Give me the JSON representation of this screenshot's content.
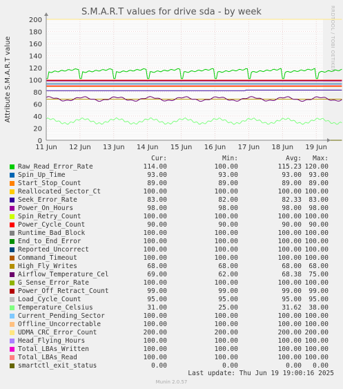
{
  "chart_data": {
    "type": "line",
    "title": "S.M.A.R.T values for drive sda - by week",
    "ylabel": "Attribute S.M.A.R.T value",
    "ylim": [
      0,
      200
    ],
    "yticks": [
      0,
      20,
      40,
      60,
      80,
      100,
      120,
      140,
      160,
      180,
      200
    ],
    "xlim": [
      "2025-06-11",
      "2025-06-19 19:00"
    ],
    "xticks": [
      "11 Jun",
      "12 Jun",
      "13 Jun",
      "14 Jun",
      "15 Jun",
      "16 Jun",
      "17 Jun",
      "18 Jun",
      "19 Jun"
    ],
    "grid": true,
    "series": [
      {
        "name": "Raw_Read_Error_Rate",
        "color": "#00cc00",
        "cur": "114.00",
        "min": "100.00",
        "avg": "115.23",
        "max": "120.00"
      },
      {
        "name": "Spin_Up_Time",
        "color": "#0066b3",
        "cur": "93.00",
        "min": "93.00",
        "avg": "93.00",
        "max": "93.00"
      },
      {
        "name": "Start_Stop_Count",
        "color": "#ff8000",
        "cur": "89.00",
        "min": "89.00",
        "avg": "89.00",
        "max": "89.00"
      },
      {
        "name": "Reallocated_Sector_Ct",
        "color": "#ffcc00",
        "cur": "100.00",
        "min": "100.00",
        "avg": "100.00",
        "max": "100.00"
      },
      {
        "name": "Seek_Error_Rate",
        "color": "#330099",
        "cur": "83.00",
        "min": "82.00",
        "avg": "82.33",
        "max": "83.00"
      },
      {
        "name": "Power_On_Hours",
        "color": "#990099",
        "cur": "98.00",
        "min": "98.00",
        "avg": "98.00",
        "max": "98.00"
      },
      {
        "name": "Spin_Retry_Count",
        "color": "#ccff00",
        "cur": "100.00",
        "min": "100.00",
        "avg": "100.00",
        "max": "100.00"
      },
      {
        "name": "Power_Cycle_Count",
        "color": "#ff0000",
        "cur": "90.00",
        "min": "90.00",
        "avg": "90.00",
        "max": "90.00"
      },
      {
        "name": "Runtime_Bad_Block",
        "color": "#808080",
        "cur": "100.00",
        "min": "100.00",
        "avg": "100.00",
        "max": "100.00"
      },
      {
        "name": "End_to_End_Error",
        "color": "#008f00",
        "cur": "100.00",
        "min": "100.00",
        "avg": "100.00",
        "max": "100.00"
      },
      {
        "name": "Reported_Uncorrect",
        "color": "#00487d",
        "cur": "100.00",
        "min": "100.00",
        "avg": "100.00",
        "max": "100.00"
      },
      {
        "name": "Command_Timeout",
        "color": "#b35a00",
        "cur": "100.00",
        "min": "100.00",
        "avg": "100.00",
        "max": "100.00"
      },
      {
        "name": "High_Fly_Writes",
        "color": "#b38f00",
        "cur": "68.00",
        "min": "68.00",
        "avg": "68.00",
        "max": "68.00"
      },
      {
        "name": "Airflow_Temperature_Cel",
        "color": "#6b006b",
        "cur": "69.00",
        "min": "62.00",
        "avg": "68.38",
        "max": "75.00"
      },
      {
        "name": "G_Sense_Error_Rate",
        "color": "#8fb300",
        "cur": "100.00",
        "min": "100.00",
        "avg": "100.00",
        "max": "100.00"
      },
      {
        "name": "Power_Off_Retract_Count",
        "color": "#b30000",
        "cur": "99.00",
        "min": "99.00",
        "avg": "99.00",
        "max": "99.00"
      },
      {
        "name": "Load_Cycle_Count",
        "color": "#bebebe",
        "cur": "95.00",
        "min": "95.00",
        "avg": "95.00",
        "max": "95.00"
      },
      {
        "name": "Temperature_Celsius",
        "color": "#80ff80",
        "cur": "31.00",
        "min": "25.00",
        "avg": "31.62",
        "max": "38.00"
      },
      {
        "name": "Current_Pending_Sector",
        "color": "#80c9ff",
        "cur": "100.00",
        "min": "100.00",
        "avg": "100.00",
        "max": "100.00"
      },
      {
        "name": "Offline_Uncorrectable",
        "color": "#ffc080",
        "cur": "100.00",
        "min": "100.00",
        "avg": "100.00",
        "max": "100.00"
      },
      {
        "name": "UDMA_CRC_Error_Count",
        "color": "#ffe680",
        "cur": "200.00",
        "min": "200.00",
        "avg": "200.00",
        "max": "200.00"
      },
      {
        "name": "Head_Flying_Hours",
        "color": "#aa80ff",
        "cur": "100.00",
        "min": "100.00",
        "avg": "100.00",
        "max": "100.00"
      },
      {
        "name": "Total_LBAs_Written",
        "color": "#ee00cc",
        "cur": "100.00",
        "min": "100.00",
        "avg": "100.00",
        "max": "100.00"
      },
      {
        "name": "Total_LBAs_Read",
        "color": "#ff8080",
        "cur": "100.00",
        "min": "100.00",
        "avg": "100.00",
        "max": "100.00"
      },
      {
        "name": "smartctl_exit_status",
        "color": "#666600",
        "cur": "0.00",
        "min": "0.00",
        "avg": "0.00",
        "max": "0.00"
      }
    ]
  },
  "legend_headers": {
    "cur": "Cur:",
    "min": "Min:",
    "avg": "Avg:",
    "max": "Max:"
  },
  "side_label": "RRDTOOL / TOBI OETIKER",
  "last_update": "Last update: Thu Jun 19 19:00:16 2025",
  "footer": "Munin 2.0.57"
}
